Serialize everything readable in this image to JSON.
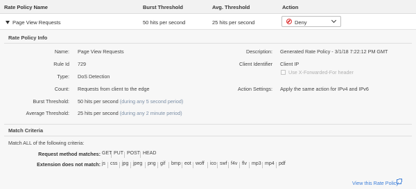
{
  "table_header": {
    "name": "Rate Policy Name",
    "burst": "Burst Threshold",
    "avg": "Avg. Threshold",
    "action": "Action"
  },
  "policy_row": {
    "name": "Page View Requests",
    "burst": "50 hits per second",
    "avg": "25 hits per second",
    "action": "Deny"
  },
  "info": {
    "title": "Rate Policy Info",
    "name_label": "Name:",
    "name_value": "Page View Requests",
    "ruleid_label": "Rule Id",
    "ruleid_value": "729",
    "type_label": "Type:",
    "type_value": "DoS Detection",
    "count_label": "Count:",
    "count_value": "Requests from client to the edge",
    "burst_label": "Burst Threshold:",
    "burst_value": "50 hits per second",
    "burst_note": "(during any 5 second period)",
    "avg_label": "Average Threshold:",
    "avg_value": "25 hits per second",
    "avg_note": "(during any 2 minute period)",
    "desc_label": "Description:",
    "desc_value": "Generated Rate Policy - 3/1/18 7:22:12 PM GMT",
    "client_label": "Client Identifier",
    "client_value": "Client IP",
    "xff_label": "Use X-Forwarded-For header",
    "action_settings_label": "Action Settings:",
    "action_settings_value": "Apply the same action for IPv4 and IPv6"
  },
  "match": {
    "title": "Match Criteria",
    "intro": "Match ALL of the following criteria:",
    "methods_label": "Request method matches:",
    "methods": [
      "GET",
      "PUT",
      "POST",
      "HEAD"
    ],
    "ext_label": "Extension does not match:",
    "extensions": [
      "js",
      "css",
      "jpg",
      "jpeg",
      "png",
      "gif",
      "bmp",
      "eot",
      "woff",
      "ico",
      "swf",
      "f4v",
      "flv",
      "mp3",
      "mp4",
      "pdf"
    ]
  },
  "footer": {
    "view_link": "View this Rate Policy"
  },
  "colors": {
    "accent": "#3b7dd8",
    "deny": "#dd3333",
    "muted": "#7c8fa6"
  }
}
